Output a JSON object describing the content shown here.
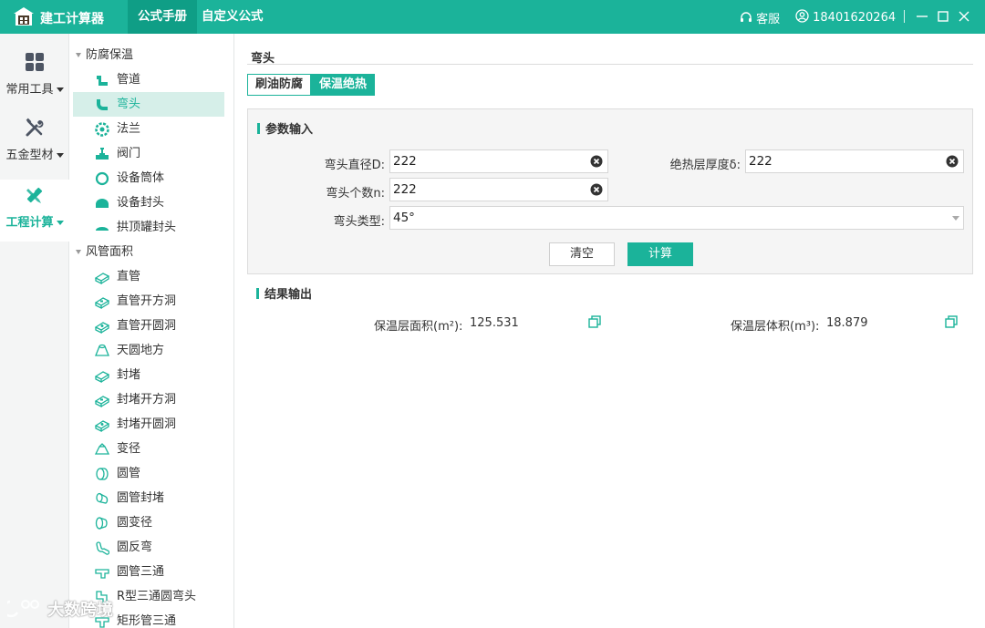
{
  "titlebar": {
    "app_title": "建工计算器",
    "tabs": [
      "公式手册",
      "自定义公式"
    ],
    "service_label": "客服",
    "user_phone": "18401620264",
    "color": "#1bb39a"
  },
  "rail": {
    "items": [
      {
        "label": "常用工具",
        "icon": "grid-icon"
      },
      {
        "label": "五金型材",
        "icon": "tools-icon"
      },
      {
        "label": "工程计算",
        "icon": "ruler-pencil-icon",
        "active": true
      }
    ]
  },
  "tree": {
    "groups": [
      {
        "label": "防腐保温",
        "items": [
          {
            "label": "管道",
            "icon": "pipe-icon"
          },
          {
            "label": "弯头",
            "icon": "elbow-icon",
            "selected": true
          },
          {
            "label": "法兰",
            "icon": "flange-icon"
          },
          {
            "label": "阀门",
            "icon": "valve-icon"
          },
          {
            "label": "设备筒体",
            "icon": "cylinder-icon"
          },
          {
            "label": "设备封头",
            "icon": "head-icon"
          },
          {
            "label": "拱顶罐封头",
            "icon": "dome-icon"
          }
        ]
      },
      {
        "label": "风管面积",
        "items": [
          {
            "label": "直管",
            "icon": "duct-icon"
          },
          {
            "label": "直管开方洞",
            "icon": "duct-square-hole-icon"
          },
          {
            "label": "直管开圆洞",
            "icon": "duct-round-hole-icon"
          },
          {
            "label": "天圆地方",
            "icon": "round-to-square-icon"
          },
          {
            "label": "封堵",
            "icon": "duct-cap-icon"
          },
          {
            "label": "封堵开方洞",
            "icon": "cap-square-hole-icon"
          },
          {
            "label": "封堵开圆洞",
            "icon": "cap-round-hole-icon"
          },
          {
            "label": "变径",
            "icon": "reducer-icon"
          },
          {
            "label": "圆管",
            "icon": "round-duct-icon"
          },
          {
            "label": "圆管封堵",
            "icon": "round-cap-icon"
          },
          {
            "label": "圆变径",
            "icon": "round-reducer-icon"
          },
          {
            "label": "圆反弯",
            "icon": "round-reverse-bend-icon"
          },
          {
            "label": "圆管三通",
            "icon": "round-tee-icon"
          },
          {
            "label": "R型三通圆弯头",
            "icon": "r-tee-elbow-icon"
          },
          {
            "label": "矩形管三通",
            "icon": "rect-tee-icon"
          }
        ]
      }
    ]
  },
  "content": {
    "title": "弯头",
    "tabs": [
      "刷油防腐",
      "保温绝热"
    ],
    "active_tab": 1,
    "params": {
      "section_title": "参数输入",
      "diameter_label": "弯头直径D:",
      "diameter_value": "222",
      "thickness_label": "绝热层厚度δ:",
      "thickness_value": "222",
      "count_label": "弯头个数n:",
      "count_value": "222",
      "type_label": "弯头类型:",
      "type_value": "45°",
      "clear_button": "清空",
      "calc_button": "计算"
    },
    "results": {
      "section_title": "结果输出",
      "area_label": "保温层面积(m²):",
      "area_value": "125.531",
      "volume_label": "保温层体积(m³):",
      "volume_value": "18.879"
    }
  },
  "watermark": "大数跨境"
}
